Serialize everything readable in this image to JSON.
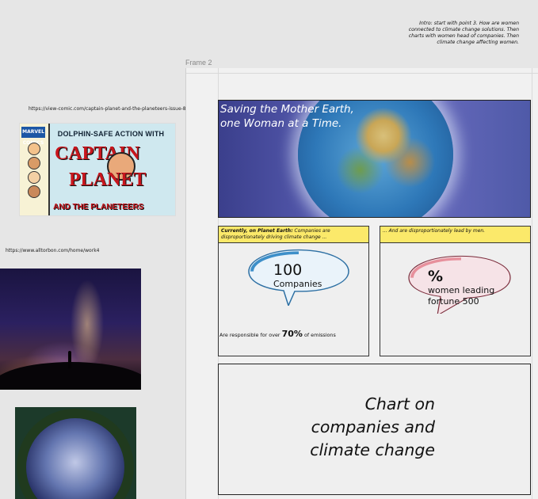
{
  "canvas": {
    "frame_label": "Frame 2",
    "note": "Intro: start with point 3. How are women connected to climate change solutions. Then charts with women head of companies. Then climate change affecting women."
  },
  "references": {
    "comic_url": "https://view-comic.com/captain-planet-and-the-planeteers-issue-8/",
    "galaxy_url": "https://www.alltorbon.com/home/work4"
  },
  "comic_cover": {
    "banner": "DOLPHIN-SAFE ACTION WITH",
    "line1": "CAPTAIN",
    "line2": "PLANET",
    "line3": "AND THE PLANETEERS",
    "publisher": "MARVEL COMICS"
  },
  "slide": {
    "hero_title": "Saving the Mother Earth, one Woman at a Time.",
    "card_left": {
      "head_bold": "Currently, on Planet Earth:",
      "head_rest": " Companies are disproportionately driving climate change ...",
      "bubble_number": "100",
      "bubble_label": "Companies",
      "emission_pre": "Are responsible for over ",
      "emission_pct": "70%",
      "emission_post": " of emissions"
    },
    "card_right": {
      "head": "... And are disproportionately lead by men.",
      "bubble_number": "%",
      "bubble_label_1": "women leading",
      "bubble_label_2": "fortune 500"
    },
    "chart_placeholder": "Chart on companies and climate change"
  },
  "colors": {
    "yellow": "#fbe96a",
    "bubble_blue": "#3d8fc9",
    "bubble_pink": "#e7909c"
  }
}
